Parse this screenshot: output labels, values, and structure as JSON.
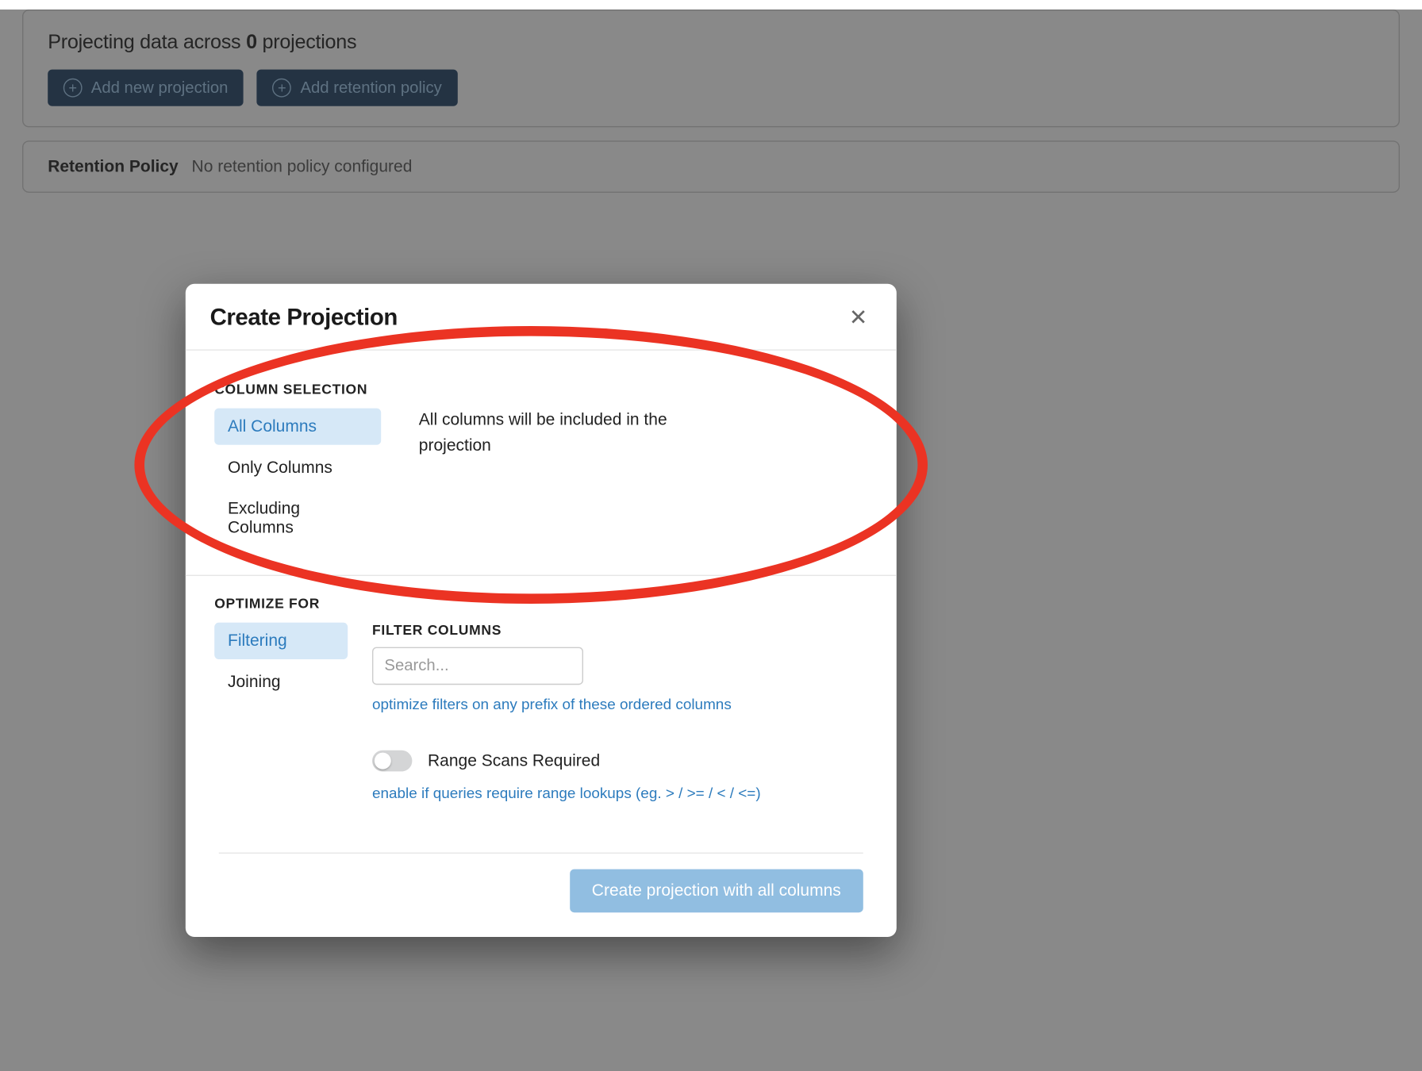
{
  "header": {
    "title_prefix": "Projecting data across ",
    "count": "0",
    "title_suffix": " projections",
    "add_projection_label": "Add new projection",
    "add_retention_label": "Add retention policy"
  },
  "retention": {
    "label": "Retention Policy",
    "status": "No retention policy configured"
  },
  "modal": {
    "title": "Create Projection",
    "column_selection": {
      "heading": "COLUMN SELECTION",
      "options": [
        "All Columns",
        "Only Columns",
        "Excluding Columns"
      ],
      "description": "All columns will be included in the projection"
    },
    "optimize": {
      "heading": "OPTIMIZE FOR",
      "options": [
        "Filtering",
        "Joining"
      ],
      "filter_heading": "FILTER COLUMNS",
      "search_placeholder": "Search...",
      "prefix_hint": "optimize filters on any prefix of these ordered columns",
      "range_label": "Range Scans Required",
      "range_hint": "enable if queries require range lookups (eg. > / >= / < / <=)"
    },
    "submit_label": "Create projection with all columns"
  }
}
